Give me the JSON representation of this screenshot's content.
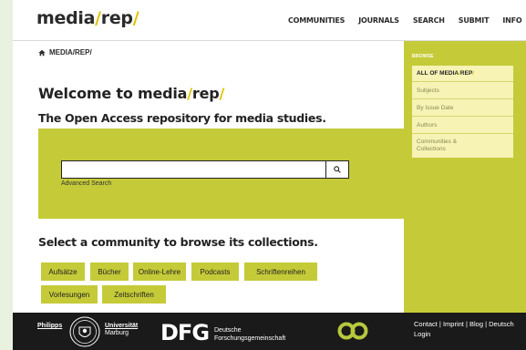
{
  "header": {
    "logo_text": "media",
    "logo_slash": "/",
    "logo_text2": "rep",
    "logo_slash2": "/",
    "nav": [
      "COMMUNITIES",
      "JOURNALS",
      "SEARCH",
      "SUBMIT",
      "INFO"
    ]
  },
  "breadcrumb": {
    "label": "MEDIA/REP/"
  },
  "main": {
    "welcome_prefix": "Welcome to media",
    "welcome_slash": "/",
    "welcome_rep": "rep",
    "welcome_slash2": "/",
    "subtitle": "The Open Access repository for media studies.",
    "search": {
      "value": "",
      "placeholder": "",
      "advanced_label": "Advanced Search"
    },
    "select_title": "Select a community to browse its collections.",
    "communities": [
      "Aufsätze",
      "Bücher",
      "Online-Lehre",
      "Podcasts",
      "Schriftenreihen",
      "Vorlesungen",
      "Zeitschriften"
    ]
  },
  "sidebar": {
    "browse_label": "BROWSE",
    "items": [
      {
        "label_a": "ALL OF MEDIA",
        "label_slash": "/",
        "label_b": "REP",
        "label_slash2": "/"
      },
      {
        "label": "Subjects"
      },
      {
        "label": "By Issue Date"
      },
      {
        "label": "Authors"
      },
      {
        "label": "Communities & Collections"
      }
    ]
  },
  "footer": {
    "philipps": "Philipps",
    "uni_line1": "Universität",
    "uni_line2": "Marburg",
    "dfg": "DFG",
    "dfg_line1": "Deutsche",
    "dfg_line2": "Forschungsgemeinschaft",
    "links_line1": "Contact | Imprint | Blog | Deutsch",
    "links_line2": "Login"
  },
  "colors": {
    "accent": "#c5cb38",
    "slash": "#e0c100",
    "sidebar_item": "#f6f3b5",
    "footer": "#1a1a1a"
  },
  "icons": {
    "home": "home-icon",
    "search": "search-icon",
    "seal": "university-seal-icon",
    "oa": "open-access-logo"
  }
}
